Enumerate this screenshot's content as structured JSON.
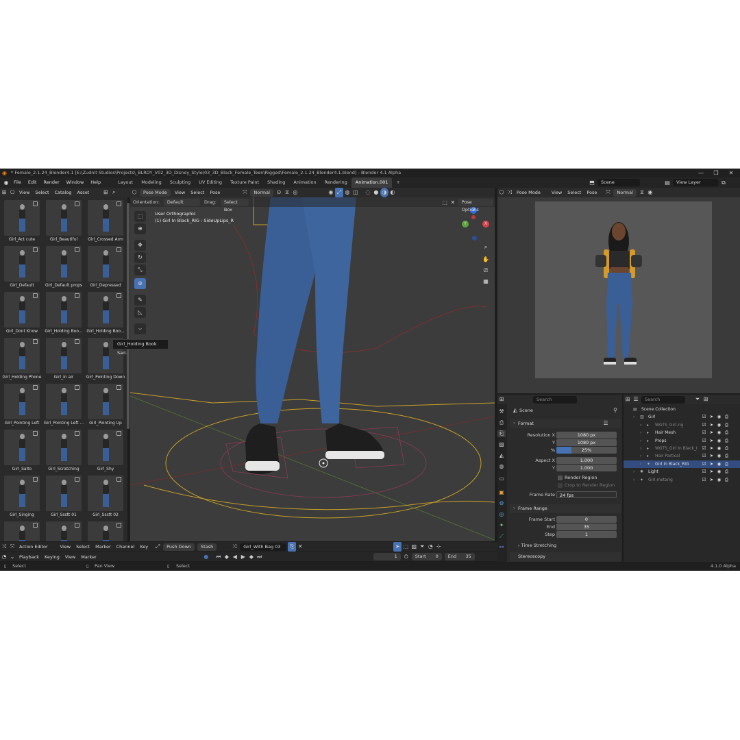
{
  "window": {
    "title": "* Female_2.1.24_Blender4.1 [E:\\Zudnit Studios\\Projects\\_BLRDY_V02_3D_Disney_Style\\03_3D_Black_Female_Teen\\Rigged\\Female_2.1.24_Blender4.1.blend] - Blender 4.1 Alpha",
    "controls": [
      "—",
      "❐",
      "✕"
    ]
  },
  "menu": [
    "File",
    "Edit",
    "Render",
    "Window",
    "Help"
  ],
  "workspaces": [
    "Layout",
    "Modeling",
    "Sculpting",
    "UV Editing",
    "Texture Paint",
    "Shading",
    "Animation",
    "Rendering",
    "Animation.001",
    "+"
  ],
  "scene_field": "Scene",
  "view_layer_field": "View Layer",
  "asset_header": [
    "View",
    "Select",
    "Catalog",
    "Asset"
  ],
  "assets": [
    "Girl_Act cute",
    "Girl_Beautiful",
    "Girl_Crossed Arm",
    "Girl_Default",
    "Girl_Default props",
    "Girl_Depressed",
    "Girl_Dont Know",
    "Girl_Holding Boo...",
    "Girl_Holding Boo...",
    "Girl_Holding Phone",
    "Girl_In air",
    "Girl_Pointing Down",
    "Girl_Pointing Left",
    "Girl_Pointing Left ...",
    "Girl_Pointing Up",
    "Girl_Salto",
    "Girl_Scratching",
    "Girl_Shy",
    "Girl_Singing",
    "Girl_Ssstt 01",
    "Girl_Ssstt 02",
    "",
    "",
    ""
  ],
  "tooltip": "Girl_Holding Book Sad.",
  "viewport": {
    "mode": "Pose Mode",
    "menus": [
      "View",
      "Select",
      "Pose"
    ],
    "shading": "Normal",
    "orientation_label": "Orientation:",
    "orientation": "Default",
    "drag_label": "Drag:",
    "drag": "Select Box",
    "pose_options": "Pose Options",
    "overlay_line1": "User Orthographic",
    "overlay_line2": "(1) Girl In Black_RIG : SideUpLips_R",
    "gizmo_axes": [
      "Z",
      "Y",
      "X"
    ]
  },
  "render_view": {
    "mode": "Pose Mode",
    "menus": [
      "View",
      "Select",
      "Pose"
    ],
    "shading": "Normal"
  },
  "properties": {
    "search_placeholder": "Search",
    "scene": "Scene",
    "format_section": "Format",
    "res_x_label": "Resolution X",
    "res_x": "1080 px",
    "res_y_label": "Y",
    "res_y": "1080 px",
    "pct_label": "%",
    "pct": "25%",
    "pct_fill": 0.25,
    "aspect_x_label": "Aspect X",
    "aspect_x": "1.000",
    "aspect_y_label": "Y",
    "aspect_y": "1.000",
    "render_region": "Render Region",
    "crop": "Crop to Render Region",
    "frame_rate_label": "Frame Rate",
    "frame_rate": "24 fps",
    "frame_range_section": "Frame Range",
    "frame_start_label": "Frame Start",
    "frame_start": "0",
    "end_label": "End",
    "end": "35",
    "step_label": "Step",
    "step": "1",
    "time_stretching": "Time Stretching",
    "stereoscopy": "Stereoscopy"
  },
  "outliner": {
    "search_placeholder": "Search",
    "items": [
      {
        "name": "Scene Collection",
        "indent": 0,
        "dim": false,
        "selected": false
      },
      {
        "name": "Girl",
        "indent": 1,
        "dim": false,
        "selected": false
      },
      {
        "name": "WGTS_Girl.rig",
        "indent": 2,
        "dim": true,
        "selected": false
      },
      {
        "name": "Hair Mesh",
        "indent": 2,
        "dim": false,
        "selected": false
      },
      {
        "name": "Props",
        "indent": 2,
        "dim": false,
        "selected": false
      },
      {
        "name": "WGTS_Girl In Black_I",
        "indent": 2,
        "dim": true,
        "selected": false
      },
      {
        "name": "Hair Partical",
        "indent": 2,
        "dim": true,
        "selected": false
      },
      {
        "name": "Girl In Black_RIG",
        "indent": 2,
        "dim": false,
        "selected": true
      },
      {
        "name": "Light",
        "indent": 1,
        "dim": false,
        "selected": false
      },
      {
        "name": "Girl.metarig",
        "indent": 1,
        "dim": true,
        "selected": false
      }
    ]
  },
  "action_editor": {
    "mode": "Action Editor",
    "menus": [
      "View",
      "Select",
      "Marker",
      "Channel",
      "Key"
    ],
    "push_down": "Push Down",
    "stash": "Stash",
    "action": "Girl_With Bag 03"
  },
  "timeline": {
    "menus": [
      "Playback",
      "Keying",
      "View",
      "Marker"
    ],
    "current_frame": "1",
    "start_label": "Start",
    "start": "0",
    "end_label": "End",
    "end": "35"
  },
  "status": {
    "left": "Select",
    "mid": "Pan View",
    "right_hint": "Select",
    "version": "4.1.0 Alpha"
  },
  "colors": {
    "accent": "#4772b3",
    "bg": "#1d1d1d",
    "panel": "#2b2b2b",
    "viewport": "#3c3c3c",
    "jeans": "#3a5e96"
  }
}
